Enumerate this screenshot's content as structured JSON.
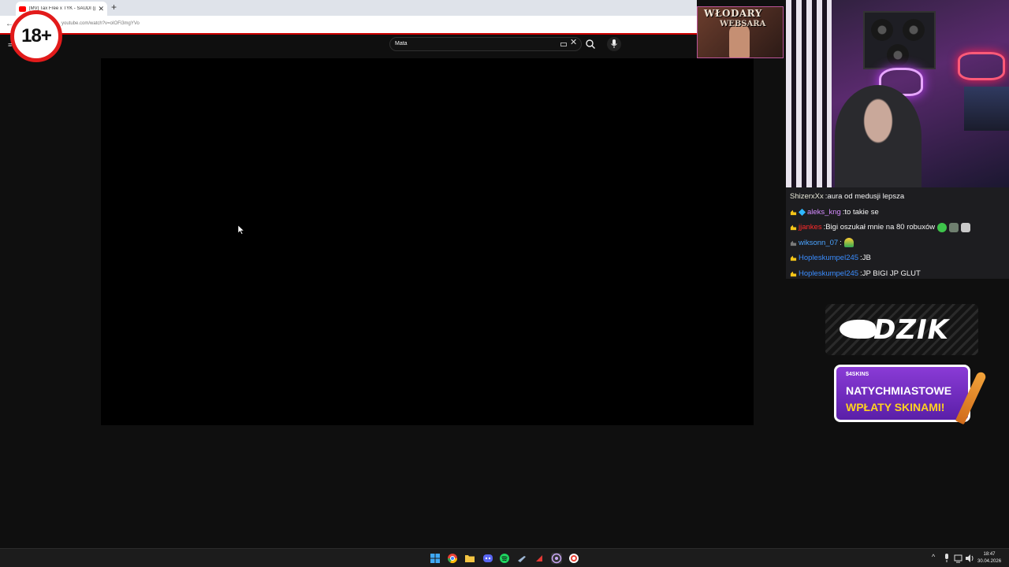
{
  "browser": {
    "tab_title": "[MV] Tax Free x TYK - SAUDI (p",
    "tab_close": "✕",
    "new_tab": "+",
    "back": "←",
    "url": "youtube.com/watch?v=oIOFi3mgYVo"
  },
  "age_badge": "18+",
  "youtube": {
    "menu": "≡",
    "search_value": "Mata",
    "clear": "✕"
  },
  "overlay_banner": {
    "line1": "WŁODARY",
    "line2": "WEBSARA"
  },
  "chat": {
    "messages": [
      {
        "user": "ShizerxXx",
        "sep": ":",
        "text": " aura od medusji lepsza",
        "user_color": "#e8e8d8",
        "badges": 0
      },
      {
        "user": "aleks_kng",
        "sep": ":",
        "text": " to takie se",
        "user_color": "#d58bff",
        "badges": 2
      },
      {
        "user": "jjankes",
        "sep": ":",
        "text": " Bigi oszukał mnie na 80 robuxów",
        "user_color": "#ff2a2a",
        "badges": 1
      },
      {
        "user": "wiksonn_07",
        "sep": ":",
        "text": "",
        "user_color": "#4aa3ff",
        "badges": 1
      },
      {
        "user": "Hopleskumpel245",
        "sep": ":",
        "text": " JB",
        "user_color": "#3a8dff",
        "badges": 1
      },
      {
        "user": "Hopleskumpel245",
        "sep": ":",
        "text": " JP BIGI JP GLUT",
        "user_color": "#3a8dff",
        "badges": 1
      }
    ]
  },
  "sponsors": {
    "dzik": "DZIK",
    "skins_logo": "$4SKINS",
    "skins_line1": "NATYCHMIASTOWE",
    "skins_line2": "WPŁATY SKINAMI!"
  },
  "taskbar": {
    "tray_up": "^",
    "time": "18:47",
    "date": "30.04.2026"
  },
  "colors": {
    "youtube_bg": "#0f0f0f",
    "accent_red": "#e21b1b",
    "skins_purple": "#7a2fc8"
  }
}
